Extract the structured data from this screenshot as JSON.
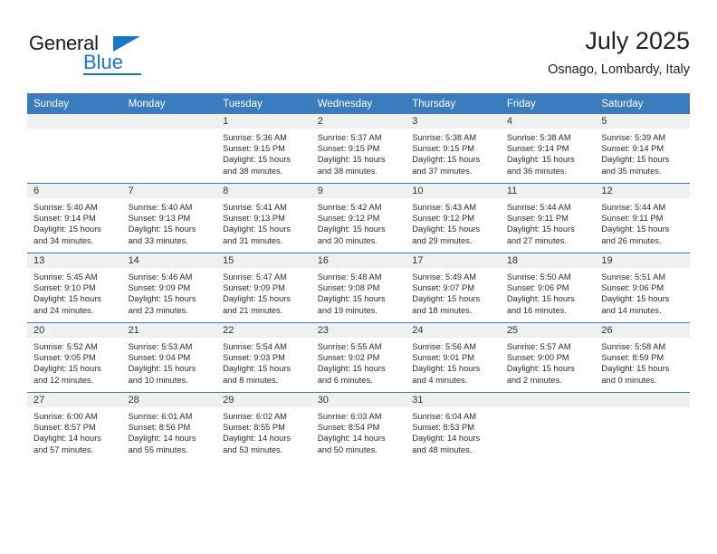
{
  "brand": {
    "name_part1": "General",
    "name_part2": "Blue",
    "triangle_icon": "triangle-icon",
    "accent_color": "#1876c8"
  },
  "header": {
    "title": "July 2025",
    "location": "Osnago, Lombardy, Italy"
  },
  "theme": {
    "header_bg": "#3a7cbe",
    "daynum_bg": "#f0f0f0",
    "grid_line": "#3a7cbe",
    "text": "#2b2b2b"
  },
  "weekday_headers": [
    "Sunday",
    "Monday",
    "Tuesday",
    "Wednesday",
    "Thursday",
    "Friday",
    "Saturday"
  ],
  "labels": {
    "sunrise_prefix": "Sunrise:",
    "sunset_prefix": "Sunset:",
    "daylight_prefix": "Daylight:"
  },
  "weeks": [
    [
      {
        "day": "",
        "sunrise": "",
        "sunset": "",
        "daylight_line1": "",
        "daylight_line2": "",
        "empty": true
      },
      {
        "day": "",
        "sunrise": "",
        "sunset": "",
        "daylight_line1": "",
        "daylight_line2": "",
        "empty": true
      },
      {
        "day": "1",
        "sunrise": "Sunrise: 5:36 AM",
        "sunset": "Sunset: 9:15 PM",
        "daylight_line1": "Daylight: 15 hours",
        "daylight_line2": "and 38 minutes.",
        "empty": false
      },
      {
        "day": "2",
        "sunrise": "Sunrise: 5:37 AM",
        "sunset": "Sunset: 9:15 PM",
        "daylight_line1": "Daylight: 15 hours",
        "daylight_line2": "and 38 minutes.",
        "empty": false
      },
      {
        "day": "3",
        "sunrise": "Sunrise: 5:38 AM",
        "sunset": "Sunset: 9:15 PM",
        "daylight_line1": "Daylight: 15 hours",
        "daylight_line2": "and 37 minutes.",
        "empty": false
      },
      {
        "day": "4",
        "sunrise": "Sunrise: 5:38 AM",
        "sunset": "Sunset: 9:14 PM",
        "daylight_line1": "Daylight: 15 hours",
        "daylight_line2": "and 36 minutes.",
        "empty": false
      },
      {
        "day": "5",
        "sunrise": "Sunrise: 5:39 AM",
        "sunset": "Sunset: 9:14 PM",
        "daylight_line1": "Daylight: 15 hours",
        "daylight_line2": "and 35 minutes.",
        "empty": false
      }
    ],
    [
      {
        "day": "6",
        "sunrise": "Sunrise: 5:40 AM",
        "sunset": "Sunset: 9:14 PM",
        "daylight_line1": "Daylight: 15 hours",
        "daylight_line2": "and 34 minutes.",
        "empty": false
      },
      {
        "day": "7",
        "sunrise": "Sunrise: 5:40 AM",
        "sunset": "Sunset: 9:13 PM",
        "daylight_line1": "Daylight: 15 hours",
        "daylight_line2": "and 33 minutes.",
        "empty": false
      },
      {
        "day": "8",
        "sunrise": "Sunrise: 5:41 AM",
        "sunset": "Sunset: 9:13 PM",
        "daylight_line1": "Daylight: 15 hours",
        "daylight_line2": "and 31 minutes.",
        "empty": false
      },
      {
        "day": "9",
        "sunrise": "Sunrise: 5:42 AM",
        "sunset": "Sunset: 9:12 PM",
        "daylight_line1": "Daylight: 15 hours",
        "daylight_line2": "and 30 minutes.",
        "empty": false
      },
      {
        "day": "10",
        "sunrise": "Sunrise: 5:43 AM",
        "sunset": "Sunset: 9:12 PM",
        "daylight_line1": "Daylight: 15 hours",
        "daylight_line2": "and 29 minutes.",
        "empty": false
      },
      {
        "day": "11",
        "sunrise": "Sunrise: 5:44 AM",
        "sunset": "Sunset: 9:11 PM",
        "daylight_line1": "Daylight: 15 hours",
        "daylight_line2": "and 27 minutes.",
        "empty": false
      },
      {
        "day": "12",
        "sunrise": "Sunrise: 5:44 AM",
        "sunset": "Sunset: 9:11 PM",
        "daylight_line1": "Daylight: 15 hours",
        "daylight_line2": "and 26 minutes.",
        "empty": false
      }
    ],
    [
      {
        "day": "13",
        "sunrise": "Sunrise: 5:45 AM",
        "sunset": "Sunset: 9:10 PM",
        "daylight_line1": "Daylight: 15 hours",
        "daylight_line2": "and 24 minutes.",
        "empty": false
      },
      {
        "day": "14",
        "sunrise": "Sunrise: 5:46 AM",
        "sunset": "Sunset: 9:09 PM",
        "daylight_line1": "Daylight: 15 hours",
        "daylight_line2": "and 23 minutes.",
        "empty": false
      },
      {
        "day": "15",
        "sunrise": "Sunrise: 5:47 AM",
        "sunset": "Sunset: 9:09 PM",
        "daylight_line1": "Daylight: 15 hours",
        "daylight_line2": "and 21 minutes.",
        "empty": false
      },
      {
        "day": "16",
        "sunrise": "Sunrise: 5:48 AM",
        "sunset": "Sunset: 9:08 PM",
        "daylight_line1": "Daylight: 15 hours",
        "daylight_line2": "and 19 minutes.",
        "empty": false
      },
      {
        "day": "17",
        "sunrise": "Sunrise: 5:49 AM",
        "sunset": "Sunset: 9:07 PM",
        "daylight_line1": "Daylight: 15 hours",
        "daylight_line2": "and 18 minutes.",
        "empty": false
      },
      {
        "day": "18",
        "sunrise": "Sunrise: 5:50 AM",
        "sunset": "Sunset: 9:06 PM",
        "daylight_line1": "Daylight: 15 hours",
        "daylight_line2": "and 16 minutes.",
        "empty": false
      },
      {
        "day": "19",
        "sunrise": "Sunrise: 5:51 AM",
        "sunset": "Sunset: 9:06 PM",
        "daylight_line1": "Daylight: 15 hours",
        "daylight_line2": "and 14 minutes.",
        "empty": false
      }
    ],
    [
      {
        "day": "20",
        "sunrise": "Sunrise: 5:52 AM",
        "sunset": "Sunset: 9:05 PM",
        "daylight_line1": "Daylight: 15 hours",
        "daylight_line2": "and 12 minutes.",
        "empty": false
      },
      {
        "day": "21",
        "sunrise": "Sunrise: 5:53 AM",
        "sunset": "Sunset: 9:04 PM",
        "daylight_line1": "Daylight: 15 hours",
        "daylight_line2": "and 10 minutes.",
        "empty": false
      },
      {
        "day": "22",
        "sunrise": "Sunrise: 5:54 AM",
        "sunset": "Sunset: 9:03 PM",
        "daylight_line1": "Daylight: 15 hours",
        "daylight_line2": "and 8 minutes.",
        "empty": false
      },
      {
        "day": "23",
        "sunrise": "Sunrise: 5:55 AM",
        "sunset": "Sunset: 9:02 PM",
        "daylight_line1": "Daylight: 15 hours",
        "daylight_line2": "and 6 minutes.",
        "empty": false
      },
      {
        "day": "24",
        "sunrise": "Sunrise: 5:56 AM",
        "sunset": "Sunset: 9:01 PM",
        "daylight_line1": "Daylight: 15 hours",
        "daylight_line2": "and 4 minutes.",
        "empty": false
      },
      {
        "day": "25",
        "sunrise": "Sunrise: 5:57 AM",
        "sunset": "Sunset: 9:00 PM",
        "daylight_line1": "Daylight: 15 hours",
        "daylight_line2": "and 2 minutes.",
        "empty": false
      },
      {
        "day": "26",
        "sunrise": "Sunrise: 5:58 AM",
        "sunset": "Sunset: 8:59 PM",
        "daylight_line1": "Daylight: 15 hours",
        "daylight_line2": "and 0 minutes.",
        "empty": false
      }
    ],
    [
      {
        "day": "27",
        "sunrise": "Sunrise: 6:00 AM",
        "sunset": "Sunset: 8:57 PM",
        "daylight_line1": "Daylight: 14 hours",
        "daylight_line2": "and 57 minutes.",
        "empty": false
      },
      {
        "day": "28",
        "sunrise": "Sunrise: 6:01 AM",
        "sunset": "Sunset: 8:56 PM",
        "daylight_line1": "Daylight: 14 hours",
        "daylight_line2": "and 55 minutes.",
        "empty": false
      },
      {
        "day": "29",
        "sunrise": "Sunrise: 6:02 AM",
        "sunset": "Sunset: 8:55 PM",
        "daylight_line1": "Daylight: 14 hours",
        "daylight_line2": "and 53 minutes.",
        "empty": false
      },
      {
        "day": "30",
        "sunrise": "Sunrise: 6:03 AM",
        "sunset": "Sunset: 8:54 PM",
        "daylight_line1": "Daylight: 14 hours",
        "daylight_line2": "and 50 minutes.",
        "empty": false
      },
      {
        "day": "31",
        "sunrise": "Sunrise: 6:04 AM",
        "sunset": "Sunset: 8:53 PM",
        "daylight_line1": "Daylight: 14 hours",
        "daylight_line2": "and 48 minutes.",
        "empty": false
      },
      {
        "day": "",
        "sunrise": "",
        "sunset": "",
        "daylight_line1": "",
        "daylight_line2": "",
        "empty": true
      },
      {
        "day": "",
        "sunrise": "",
        "sunset": "",
        "daylight_line1": "",
        "daylight_line2": "",
        "empty": true
      }
    ]
  ]
}
